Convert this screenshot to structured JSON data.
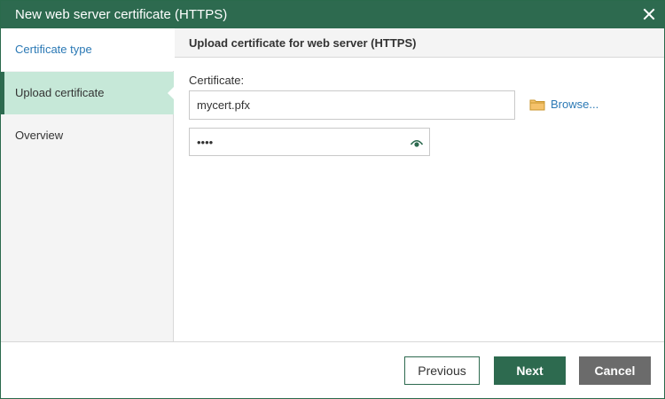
{
  "window": {
    "title": "New web server certificate (HTTPS)",
    "close_icon": "close-icon"
  },
  "sidebar": {
    "items": [
      {
        "label": "Certificate type",
        "state": "link"
      },
      {
        "label": "Upload certificate",
        "state": "active"
      },
      {
        "label": "Overview",
        "state": "inactive"
      }
    ]
  },
  "main": {
    "header": "Upload certificate for web server (HTTPS)",
    "certificate_label": "Certificate:",
    "certificate_value": "mycert.pfx",
    "browse_label": "Browse...",
    "browse_icon": "folder-icon",
    "password_value": "••••",
    "password_toggle_icon": "eye-icon"
  },
  "footer": {
    "previous_label": "Previous",
    "next_label": "Next",
    "cancel_label": "Cancel"
  },
  "colors": {
    "brand_green": "#2d6a4f",
    "active_step_bg": "#c6e8d8",
    "link_blue": "#2b79b5",
    "cancel_gray": "#6b6b6b"
  }
}
